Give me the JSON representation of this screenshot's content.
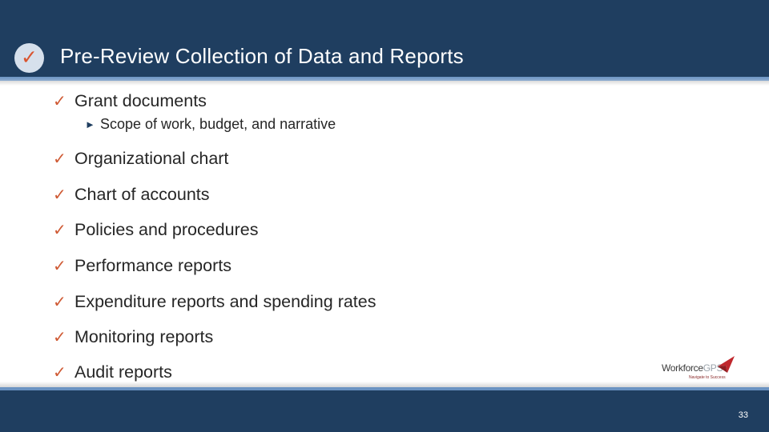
{
  "header": {
    "title": "Pre-Review Collection of Data and Reports",
    "badge_icon": "checkmark-icon",
    "badge_glyph": "✓"
  },
  "bullets": {
    "check_glyph": "✓",
    "sub_glyph": "►",
    "items": [
      {
        "label": "Grant documents",
        "sub": [
          "Scope of work, budget, and narrative"
        ]
      },
      {
        "label": "Organizational chart"
      },
      {
        "label": "Chart of accounts"
      },
      {
        "label": "Policies and procedures"
      },
      {
        "label": "Performance reports"
      },
      {
        "label": "Expenditure reports and spending rates"
      },
      {
        "label": "Monitoring reports"
      },
      {
        "label": "Audit reports"
      }
    ]
  },
  "logo": {
    "brand_main": "Workforce",
    "brand_accent": "GPS",
    "tagline": "Navigate to Success"
  },
  "footer": {
    "page_number": "33"
  },
  "colors": {
    "header_bg": "#1f3e60",
    "accent_stripe": "#6b93c2",
    "check_color": "#cf5a34",
    "text": "#262626"
  }
}
